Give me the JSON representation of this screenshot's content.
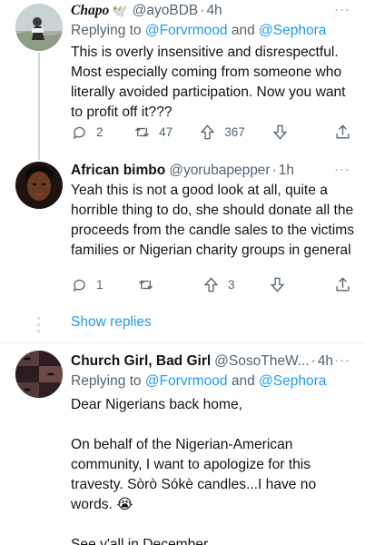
{
  "tweets": [
    {
      "name": "Chapo",
      "badge": "🕊️",
      "handle": "@ayoBDB",
      "time": "4h",
      "replying_prefix": "Replying to ",
      "mention1": "@Forvrmood",
      "and": " and ",
      "mention2": "@Sephora",
      "text": "This is overly insensitive and disrespectful. Most especially coming from someone who literally avoided participation. Now you want to profit off it???",
      "replies": "2",
      "retweets": "47",
      "likes": "367"
    },
    {
      "name": "African bimbo",
      "handle": "@yorubapepper",
      "time": "1h",
      "text": "Yeah this is not a good look at all, quite a horrible thing to do, she should donate all the proceeds from the candle sales to the victims families or Nigerian charity groups in general",
      "replies": "1",
      "retweets": "",
      "likes": "3"
    },
    {
      "name": "Church Girl, Bad Girl",
      "handle": "@SosoTheW...",
      "time": "4h",
      "replying_prefix": "Replying to ",
      "mention1": "@Forvrmood",
      "and": " and ",
      "mention2": "@Sephora",
      "p1": "Dear Nigerians back home,",
      "p2": "On behalf of the Nigerian-American community, I want to apologize for this travesty. Sòrò Sókè candles...I have no words. 😭",
      "p3": "See y'all in December."
    }
  ],
  "show_replies": "Show replies",
  "more": "···",
  "sep": "·",
  "colors": {
    "accent": "#1d9bf0",
    "muted": "#536471",
    "text": "#0f1419"
  }
}
